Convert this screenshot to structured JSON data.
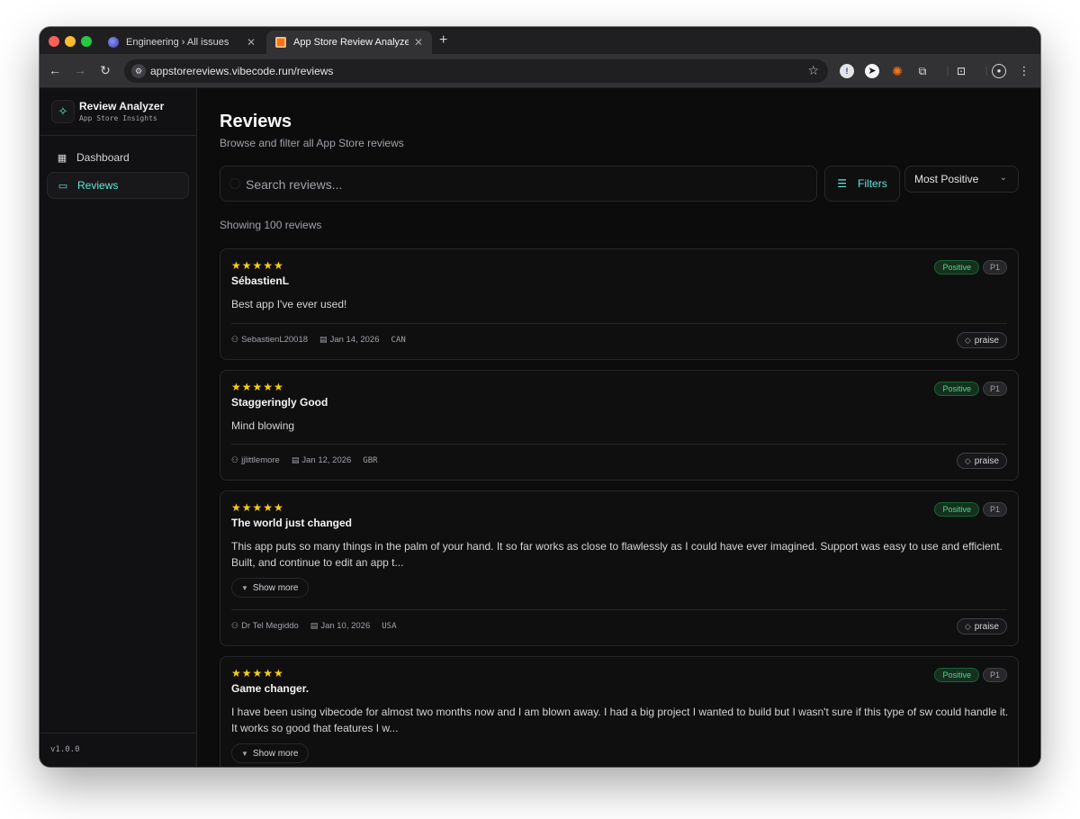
{
  "browser": {
    "tabs": [
      {
        "title": "Engineering › All issues",
        "close": "✕"
      },
      {
        "title": "App Store Review Analyzer",
        "close": "✕"
      }
    ],
    "new_tab": "+",
    "url": "appstorereviews.vibecode.run/reviews",
    "icons": [
      "back-arrow-icon",
      "forward-arrow-icon",
      "reload-icon",
      "site-settings-icon",
      "bookmark-star-icon",
      "password-manager-icon",
      "compass-icon",
      "sparkle-icon",
      "extensions-icon",
      "tab-search-icon",
      "profile-icon",
      "more-menu-icon"
    ]
  },
  "sidebar": {
    "brand_name": "Review Analyzer",
    "brand_sub": "App Store Insights",
    "items": [
      {
        "label": "Dashboard",
        "icon": "grid-icon"
      },
      {
        "label": "Reviews",
        "icon": "message-icon",
        "active": true
      }
    ],
    "version": "v1.0.0"
  },
  "main": {
    "title": "Reviews",
    "subtitle": "Browse and filter all App Store reviews",
    "search_placeholder": "Search reviews...",
    "filters_label": "Filters",
    "sort_label": "Most Positive",
    "count_text": "Showing 100 reviews"
  },
  "reviews": [
    {
      "stars": "★★★★★",
      "title": "SébastienL",
      "body": "Best app I've ever used!",
      "author": "SebastienL20018",
      "date": "Jan 14, 2026",
      "country": "CAN",
      "sentiment": "Positive",
      "priority": "P1",
      "tag": "praise",
      "show_more": ""
    },
    {
      "stars": "★★★★★",
      "title": "Staggeringly Good",
      "body": "Mind blowing",
      "author": "jjlittlemore",
      "date": "Jan 12, 2026",
      "country": "GBR",
      "sentiment": "Positive",
      "priority": "P1",
      "tag": "praise",
      "show_more": ""
    },
    {
      "stars": "★★★★★",
      "title": "The world just changed",
      "body": "This app puts so many things in the palm of your hand. It so far works as close to flawlessly as I could have ever imagined. Support was easy to use and efficient. Built, and continue to edit an app t...",
      "author": "Dr Tel Megiddo",
      "date": "Jan 10, 2026",
      "country": "USA",
      "sentiment": "Positive",
      "priority": "P1",
      "tag": "praise",
      "show_more": "Show more"
    },
    {
      "stars": "★★★★★",
      "title": "Game changer.",
      "body": "I have been using vibecode for almost two months now and I am blown away. I had a big project I wanted to build but I wasn't sure if this type of sw could handle it. It works so good that features I w...",
      "sentiment": "Positive",
      "priority": "P1",
      "show_more": "Show more"
    }
  ],
  "colors": {
    "accent": "#5eead4",
    "star": "#facc15",
    "positive": "#4ade80",
    "background": "#0c0c0d"
  }
}
